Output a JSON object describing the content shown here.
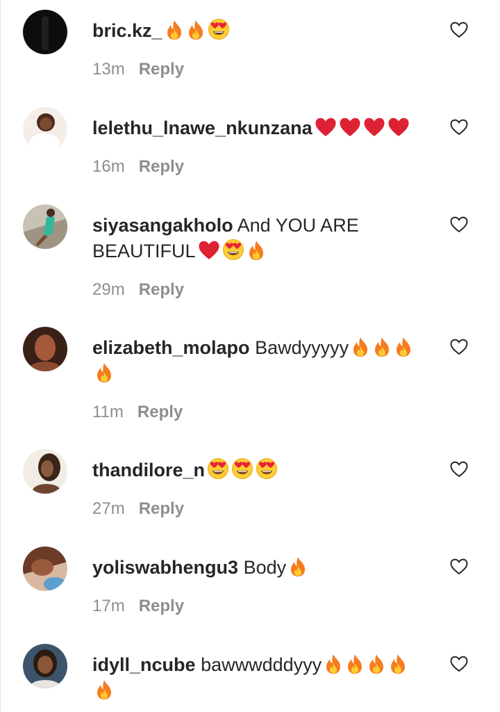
{
  "comments": [
    {
      "username": "bric.kz_",
      "text": "",
      "emojis": [
        "fire",
        "fire",
        "heart-eyes"
      ],
      "trailing_emojis": [],
      "time": "13m",
      "reply_label": "Reply",
      "avatar_colors": [
        "#0d0d0d",
        "#1f1f1f"
      ]
    },
    {
      "username": "lelethu_lnawe_nkunzana",
      "text": "",
      "emojis": [
        "heart",
        "heart",
        "heart",
        "heart"
      ],
      "trailing_emojis": [],
      "time": "16m",
      "reply_label": "Reply",
      "avatar_colors": [
        "#e9d5c8",
        "#5a3522"
      ]
    },
    {
      "username": "siyasangakholo",
      "text": "And YOU ARE BEAUTIFUL",
      "emojis": [
        "heart",
        "heart-eyes",
        "fire"
      ],
      "trailing_emojis": [],
      "time": "29m",
      "reply_label": "Reply",
      "avatar_colors": [
        "#b9b3a6",
        "#2fb89a"
      ]
    },
    {
      "username": "elizabeth_molapo",
      "text": "Bawdyyyyy",
      "emojis": [
        "fire",
        "fire",
        "fire"
      ],
      "trailing_emojis": [
        "fire"
      ],
      "time": "11m",
      "reply_label": "Reply",
      "avatar_colors": [
        "#3a2016",
        "#a4593a"
      ]
    },
    {
      "username": "thandilore_n",
      "text": "",
      "emojis": [
        "heart-eyes",
        "heart-eyes",
        "heart-eyes"
      ],
      "trailing_emojis": [],
      "time": "27m",
      "reply_label": "Reply",
      "avatar_colors": [
        "#f2ede4",
        "#3a241a"
      ]
    },
    {
      "username": "yoliswabhengu3",
      "text": "Body",
      "emojis": [
        "fire"
      ],
      "trailing_emojis": [],
      "time": "17m",
      "reply_label": "Reply",
      "avatar_colors": [
        "#6b3b27",
        "#d8b8a0"
      ]
    },
    {
      "username": "idyll_ncube",
      "text": "bawwwdddyyy",
      "emojis": [
        "fire",
        "fire",
        "fire",
        "fire"
      ],
      "trailing_emojis": [
        "fire"
      ],
      "time": "",
      "reply_label": "",
      "avatar_colors": [
        "#3c556a",
        "#4a2d20"
      ]
    }
  ],
  "icons": {
    "like": "heart-outline-icon"
  }
}
